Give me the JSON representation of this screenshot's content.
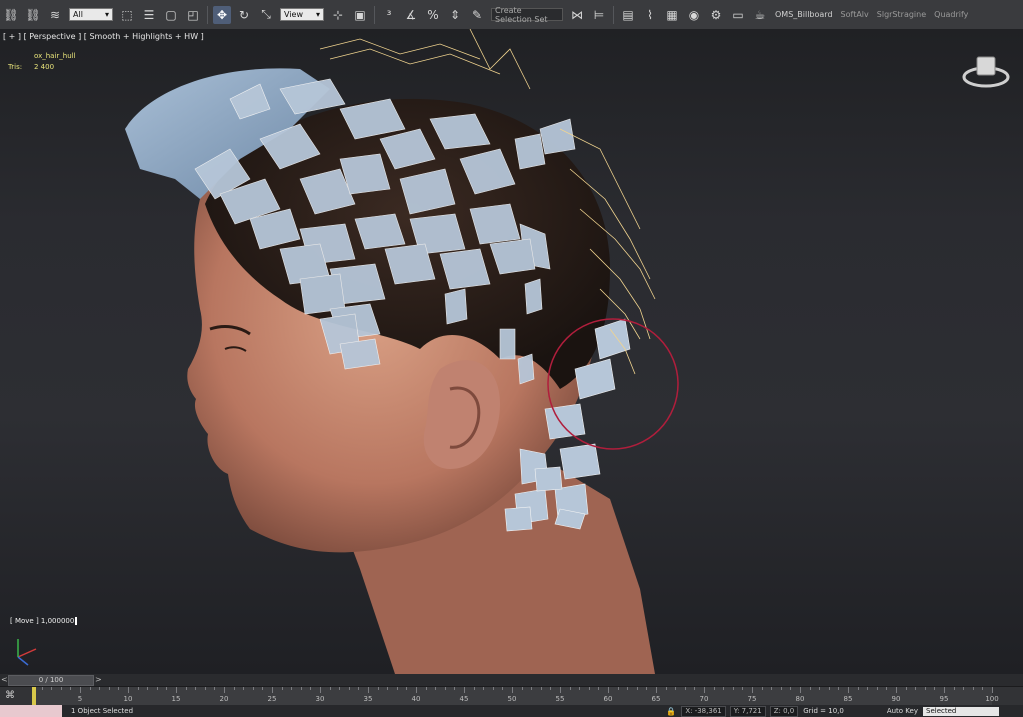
{
  "toolbar": {
    "selection_filter": "All",
    "ref_coord": "View",
    "named_selection": "Create Selection Set",
    "items": [
      "OMS_Billboard",
      "SoftAlv",
      "SlgrStragine",
      "Quadrify"
    ]
  },
  "viewport": {
    "label": "[ + ] [ Perspective ] [ Smooth + Highlights + HW ]",
    "object_name": "ox_hair_hull",
    "tris_label": "Tris:",
    "tris_value": "2 400",
    "move_readout": "[ Move ] 1,000000"
  },
  "timeline": {
    "frame": "0 / 100",
    "prev_arrow": "<",
    "next_arrow": ">",
    "ticks": [
      "5",
      "10",
      "15",
      "20",
      "25",
      "30",
      "35",
      "40",
      "45",
      "50",
      "55",
      "60",
      "65",
      "70",
      "75",
      "80",
      "85",
      "90",
      "95",
      "100"
    ]
  },
  "status": {
    "selection": "1 Object Selected",
    "x": "X: -38,361",
    "y": "Y: 7,721",
    "z": "Z: 0,0",
    "grid": "Grid = 10,0",
    "auto_key": "Auto Key",
    "key_mode": "Selected"
  },
  "icons": [
    "select-link-icon",
    "unlink-icon",
    "bind-spacewarp-icon",
    "select-object-icon",
    "select-by-name-icon",
    "rect-region-icon",
    "window-crossing-icon",
    "move-icon",
    "rotate-icon",
    "scale-icon",
    "pivot-icon",
    "select-manipulate-icon",
    "snap-icon",
    "angle-snap-icon",
    "percent-snap-icon",
    "spinner-snap-icon",
    "edit-named-sel-icon",
    "mirror-icon",
    "align-icon",
    "layer-icon",
    "curve-editor-icon",
    "schematic-icon",
    "material-editor-icon",
    "render-setup-icon",
    "render-frame-icon",
    "render-icon",
    "teapot-icon",
    "view-cube-icon"
  ],
  "colors": {
    "toolbar_bg": "#3a3b3e",
    "active_tool": "#4f5e78",
    "brush_circle": "#b01e3c",
    "object_label": "#e8e37a",
    "key_slider": "#d8c84a"
  }
}
